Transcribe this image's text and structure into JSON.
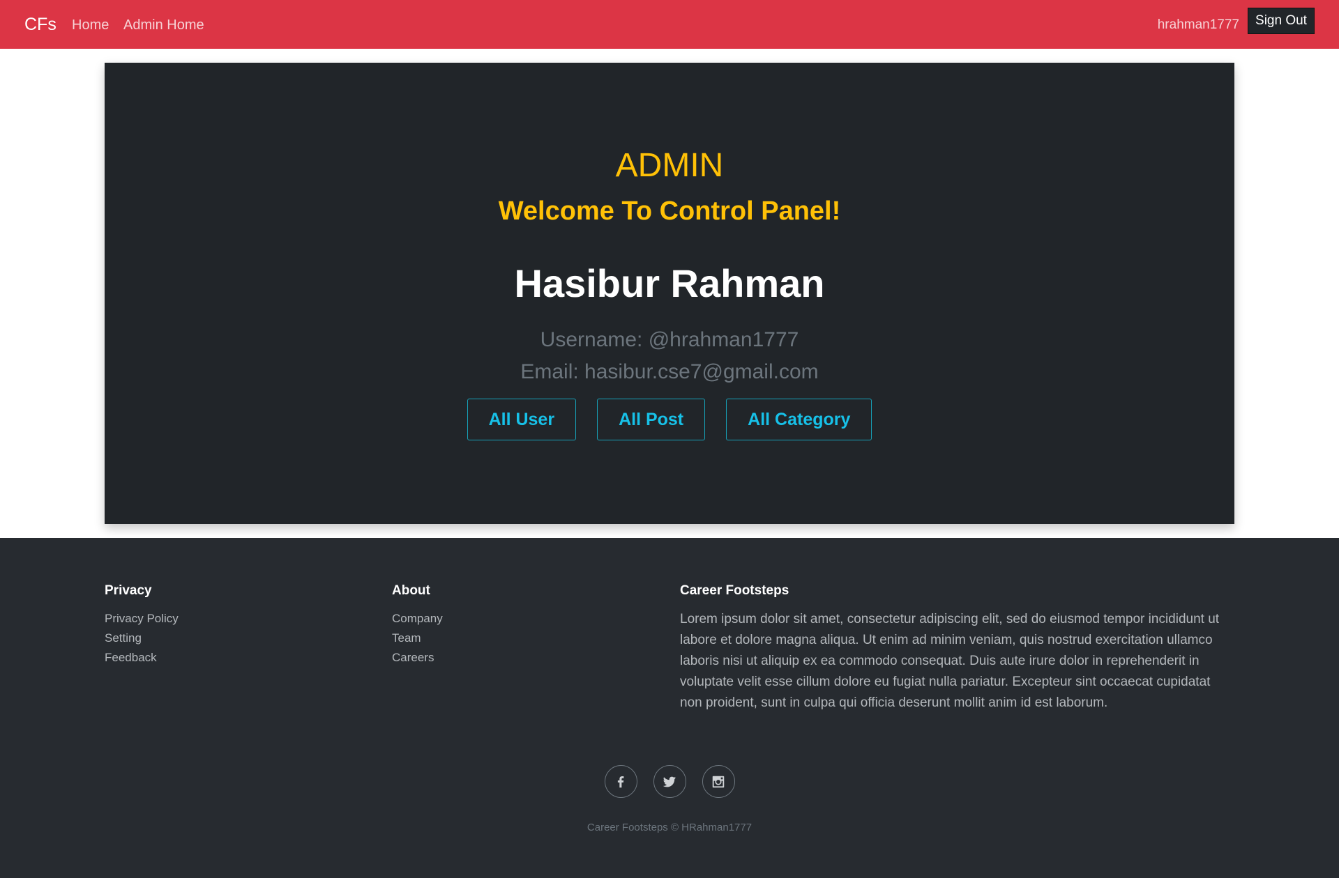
{
  "navbar": {
    "brand": "CFs",
    "links": [
      "Home",
      "Admin Home"
    ],
    "username": "hrahman1777",
    "sign_out_label": "Sign Out",
    "color": "#dc3545"
  },
  "panel": {
    "title": "ADMIN",
    "subtitle": "Welcome To Control Panel!",
    "name": "Hasibur Rahman",
    "username_line": "Username: @hrahman1777",
    "email_line": "Email: hasibur.cse7@gmail.com",
    "buttons": [
      "All User",
      "All Post",
      "All Category"
    ],
    "accent_color": "#ffc107",
    "button_color": "#17a2b8"
  },
  "footer": {
    "privacy": {
      "heading": "Privacy",
      "links": [
        "Privacy Policy",
        "Setting",
        "Feedback"
      ]
    },
    "about": {
      "heading": "About",
      "links": [
        "Company",
        "Team",
        "Careers"
      ]
    },
    "career": {
      "heading": "Career Footsteps",
      "text": "Lorem ipsum dolor sit amet, consectetur adipiscing elit, sed do eiusmod tempor incididunt ut labore et dolore magna aliqua. Ut enim ad minim veniam, quis nostrud exercitation ullamco laboris nisi ut aliquip ex ea commodo consequat. Duis aute irure dolor in reprehenderit in voluptate velit esse cillum dolore eu fugiat nulla pariatur. Excepteur sint occaecat cupidatat non proident, sunt in culpa qui officia deserunt mollit anim id est laborum."
    },
    "socials": [
      "facebook-icon",
      "twitter-icon",
      "instagram-icon"
    ],
    "copyright": "Career Footsteps © HRahman1777"
  }
}
